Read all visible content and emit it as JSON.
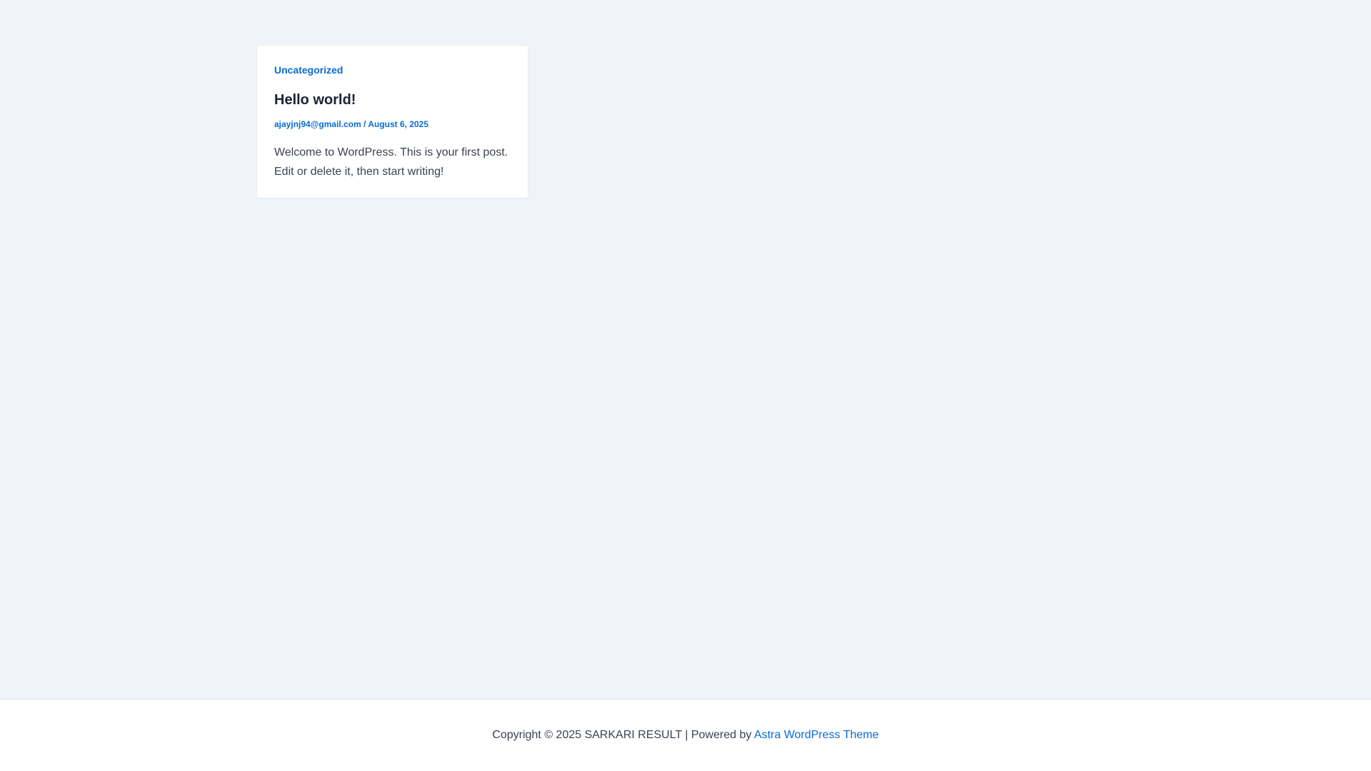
{
  "post": {
    "category": "Uncategorized",
    "title": "Hello world!",
    "author": "ajayjnj94@gmail.com",
    "separator": " / ",
    "date": "August 6, 2025",
    "excerpt": "Welcome to WordPress. This is your first post. Edit or delete it, then start writing!"
  },
  "footer": {
    "copyright": "Copyright © 2025 SARKARI RESULT | Powered by ",
    "theme_link": "Astra WordPress Theme"
  },
  "colors": {
    "background": "#eef4f8",
    "accent": "#0a6bd1",
    "heading": "#1a2233",
    "body_text": "#3b4250"
  }
}
